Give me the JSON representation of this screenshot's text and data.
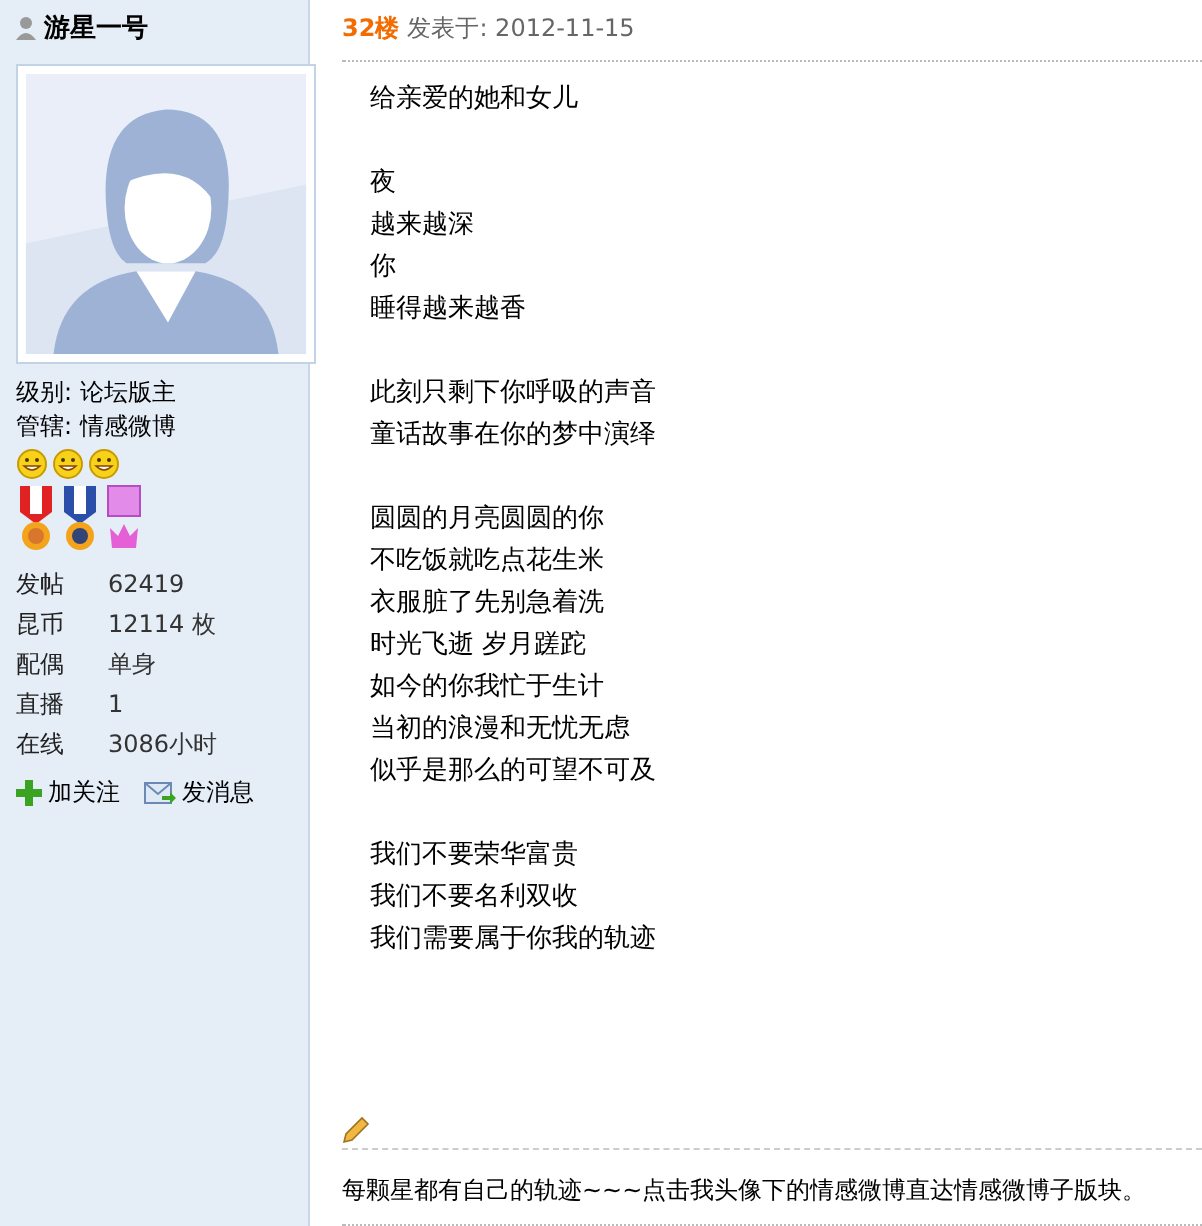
{
  "user": {
    "name": "游星一号",
    "level_label": "级别:",
    "level": "论坛版主",
    "manages_label": "管辖:",
    "manages": "情感微博",
    "stats": [
      {
        "label": "发帖",
        "value": "62419"
      },
      {
        "label": "昆币",
        "value": "12114 枚"
      },
      {
        "label": "配偶",
        "value": "单身"
      },
      {
        "label": "直播",
        "value": "1"
      },
      {
        "label": "在线",
        "value": "3086小时"
      }
    ],
    "actions": [
      {
        "kind": "follow",
        "label": "加关注"
      },
      {
        "kind": "message",
        "label": "发消息"
      }
    ]
  },
  "post": {
    "floor": "32楼",
    "posted": "发表于: 2012-11-15",
    "stanzas": [
      [
        "给亲爱的她和女儿"
      ],
      [
        "夜",
        "越来越深",
        "你",
        "睡得越来越香"
      ],
      [
        "此刻只剩下你呼吸的声音",
        "童话故事在你的梦中演绎"
      ],
      [
        "圆圆的月亮圆圆的你",
        "不吃饭就吃点花生米",
        "衣服脏了先别急着洗",
        "时光飞逝 岁月蹉跎",
        "如今的你我忙于生计",
        "当初的浪漫和无忧无虑",
        "似乎是那么的可望不可及"
      ],
      [
        "我们不要荣华富贵",
        "我们不要名利双收",
        "我们需要属于你我的轨迹"
      ]
    ],
    "signature": "每颗星都有自己的轨迹~~~点击我头像下的情感微博直达情感微博子版块。"
  }
}
